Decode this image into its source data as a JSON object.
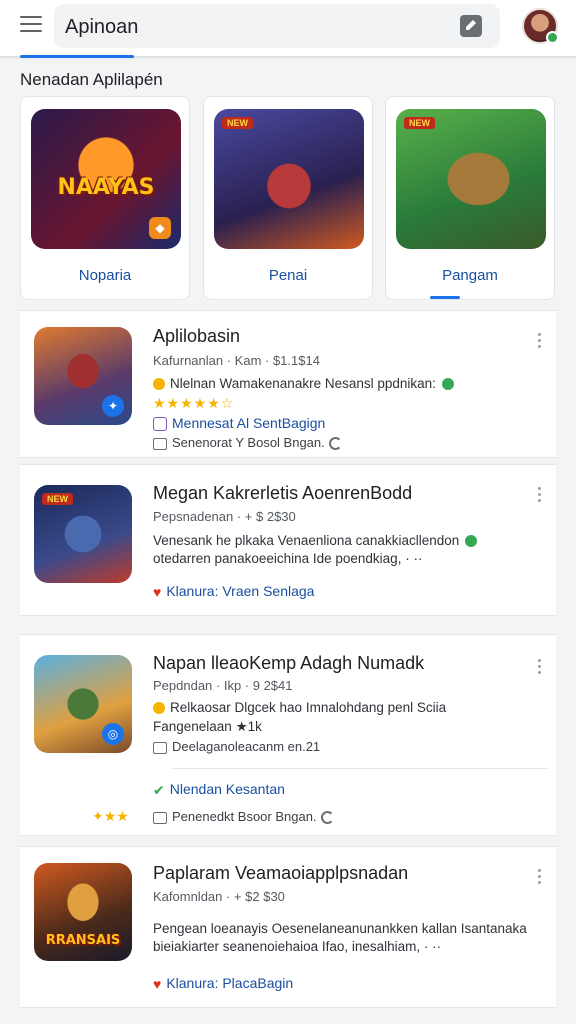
{
  "search": {
    "value": "Apinoan"
  },
  "section": {
    "title": "Nenadan Aplilapén"
  },
  "featured": [
    {
      "label": "Noparia",
      "art_text": "NAAYAS",
      "selected": false
    },
    {
      "label": "Penai",
      "art_text": "",
      "selected": false
    },
    {
      "label": "Pangam",
      "art_text": "",
      "selected": true
    }
  ],
  "items": [
    {
      "title": "Aplilobasin",
      "meta": "Kafurnanlan · Kam · $1.1$14",
      "line1": "Nlelnan Wamakenanakre Nesansl ppdnikan:",
      "rating_stars": "★★★★★☆",
      "link": "Mennesat Al SentBagign",
      "small": "Senenorat Y Bosol Bngan."
    },
    {
      "title": "Megan Kakrerletis AoenrenBodd",
      "meta": "Pepsnadenan · + $ 2$30",
      "line1": "Venesank he plkaka Venaenliona canakkiacllendon",
      "line2": "otedarren panakoeeichina Ide poendkiag, · ··",
      "link": "Klanura: Vraen Senlaga"
    },
    {
      "title": "Napan lleaoKemp Adagh Numadk",
      "meta": "Pepdndan · Ikp · 9 2$41",
      "line1": "Relkaosar Dlgcek hao Imnalohdang penl Sciia",
      "line2": "Fangenelaan ★1k",
      "small": "Deelaganoleacanm en.21",
      "link": "Nlendan Kesantan",
      "small2": "Penenedkt Bsoor Bngan."
    },
    {
      "title": "Paplaram Veamaoiapplpsnadan",
      "meta": "Kafomnldan · + $2 $30",
      "line1": "Pengean loeanayis Oesenelaneanunankken kallan Isantanaka",
      "line2": "bieiakiarter seanenoiehaioa Ifao, inesalhiam, · ··",
      "link": "Klanura: PlacaBagin"
    }
  ]
}
